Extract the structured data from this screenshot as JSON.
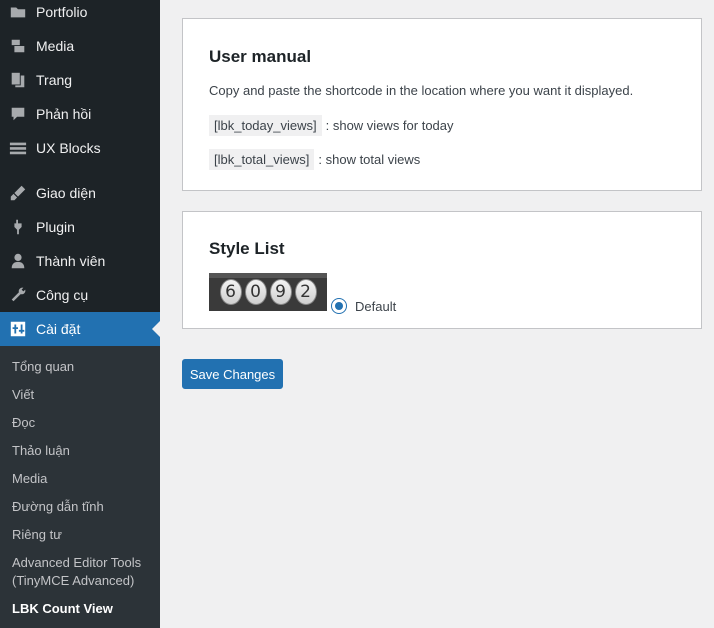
{
  "sidebar": {
    "items": [
      {
        "label": "Portfolio",
        "icon": "folder-icon"
      },
      {
        "label": "Media",
        "icon": "media-icon"
      },
      {
        "label": "Trang",
        "icon": "pages-icon"
      },
      {
        "label": "Phản hồi",
        "icon": "comments-icon"
      },
      {
        "label": "UX Blocks",
        "icon": "blocks-icon"
      },
      {
        "label": "Giao diện",
        "icon": "appearance-icon"
      },
      {
        "label": "Plugin",
        "icon": "plugin-icon"
      },
      {
        "label": "Thành viên",
        "icon": "users-icon"
      },
      {
        "label": "Công cụ",
        "icon": "tools-icon"
      },
      {
        "label": "Cài đặt",
        "icon": "settings-icon",
        "active": true
      }
    ],
    "submenu": [
      {
        "label": "Tổng quan"
      },
      {
        "label": "Viết"
      },
      {
        "label": "Đọc"
      },
      {
        "label": "Thảo luận"
      },
      {
        "label": "Media"
      },
      {
        "label": "Đường dẫn tĩnh"
      },
      {
        "label": "Riêng tư"
      },
      {
        "label": "Advanced Editor Tools (TinyMCE Advanced)"
      },
      {
        "label": "LBK Count View",
        "current": true
      }
    ]
  },
  "manual": {
    "title": "User manual",
    "intro": "Copy and paste the shortcode in the location where you want it displayed.",
    "shortcodes": [
      {
        "code": "[lbk_today_views]",
        "desc": ": show views for today"
      },
      {
        "code": "[lbk_total_views]",
        "desc": ": show total views"
      }
    ]
  },
  "style_list": {
    "title": "Style List",
    "counter_digits": [
      "6",
      "0",
      "9",
      "2"
    ],
    "option_label": "Default",
    "selected": true
  },
  "save_label": "Save Changes",
  "colors": {
    "sidebar_bg": "#1d2327",
    "submenu_bg": "#2c3338",
    "accent": "#2271b1",
    "page_bg": "#f0f0f1"
  }
}
